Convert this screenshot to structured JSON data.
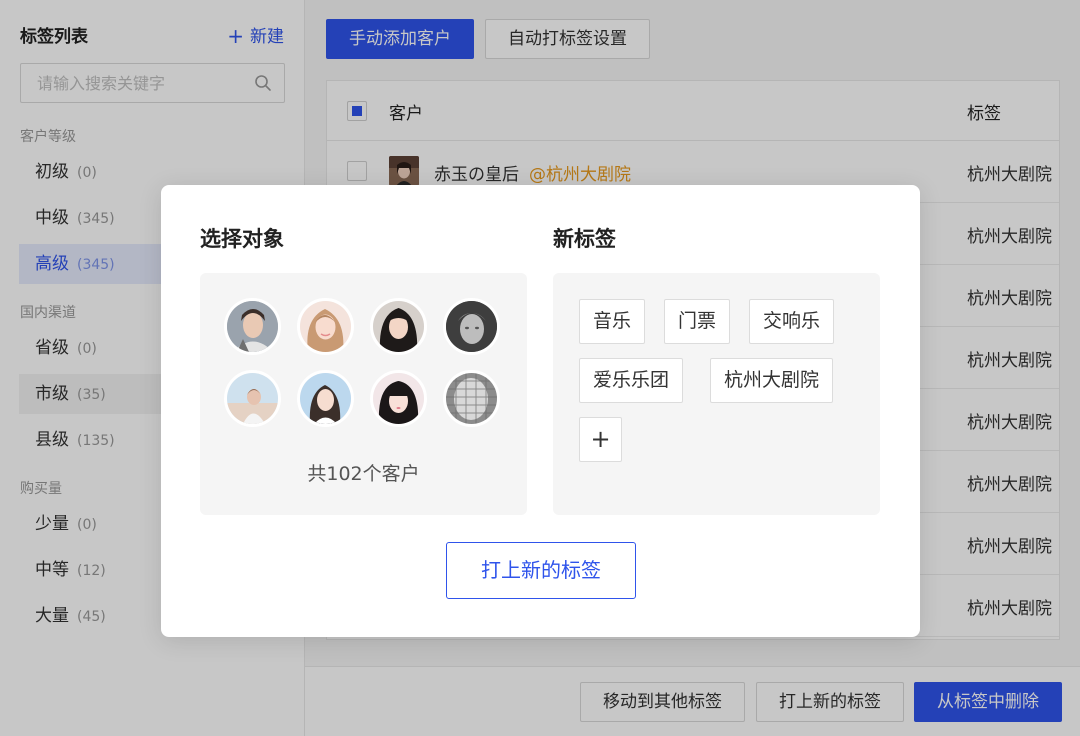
{
  "colors": {
    "accent": "#2f54eb",
    "mention": "#e89a1e"
  },
  "sidebar": {
    "title": "标签列表",
    "new_label": "新建",
    "search_placeholder": "请输入搜索关键字",
    "groups": [
      {
        "title": "客户等级",
        "items": [
          {
            "label": "初级",
            "count": "(0)"
          },
          {
            "label": "中级",
            "count": "(345)"
          },
          {
            "label": "高级",
            "count": "(345)",
            "state": "active"
          }
        ]
      },
      {
        "title": "国内渠道",
        "items": [
          {
            "label": "省级",
            "count": "(0)"
          },
          {
            "label": "市级",
            "count": "(35)",
            "state": "hover"
          },
          {
            "label": "县级",
            "count": "(135)"
          }
        ]
      },
      {
        "title": "购买量",
        "items": [
          {
            "label": "少量",
            "count": "(0)"
          },
          {
            "label": "中等",
            "count": "(12)"
          },
          {
            "label": "大量",
            "count": "(45)"
          }
        ]
      }
    ]
  },
  "toolbar": {
    "add_label": "手动添加客户",
    "auto_label": "自动打标签设置"
  },
  "table": {
    "columns": [
      "客户",
      "标签"
    ],
    "rows": [
      {
        "name": "赤玉の皇后",
        "mention": "@杭州大剧院",
        "tag": "杭州大剧院"
      },
      {
        "tag": "杭州大剧院"
      },
      {
        "tag": "杭州大剧院"
      },
      {
        "tag": "杭州大剧院"
      },
      {
        "tag": "杭州大剧院"
      },
      {
        "tag": "杭州大剧院"
      },
      {
        "tag": "杭州大剧院"
      },
      {
        "tag": "杭州大剧院"
      }
    ]
  },
  "footer": {
    "move_label": "移动到其他标签",
    "tag_label": "打上新的标签",
    "delete_label": "从标签中删除"
  },
  "modal": {
    "select_title": "选择对象",
    "new_tag_title": "新标签",
    "total_label": "共102个客户",
    "tags": [
      "音乐",
      "门票",
      "交响乐",
      "爱乐乐团",
      "杭州大剧院"
    ],
    "add_tag_label": "+",
    "confirm_label": "打上新的标签"
  }
}
